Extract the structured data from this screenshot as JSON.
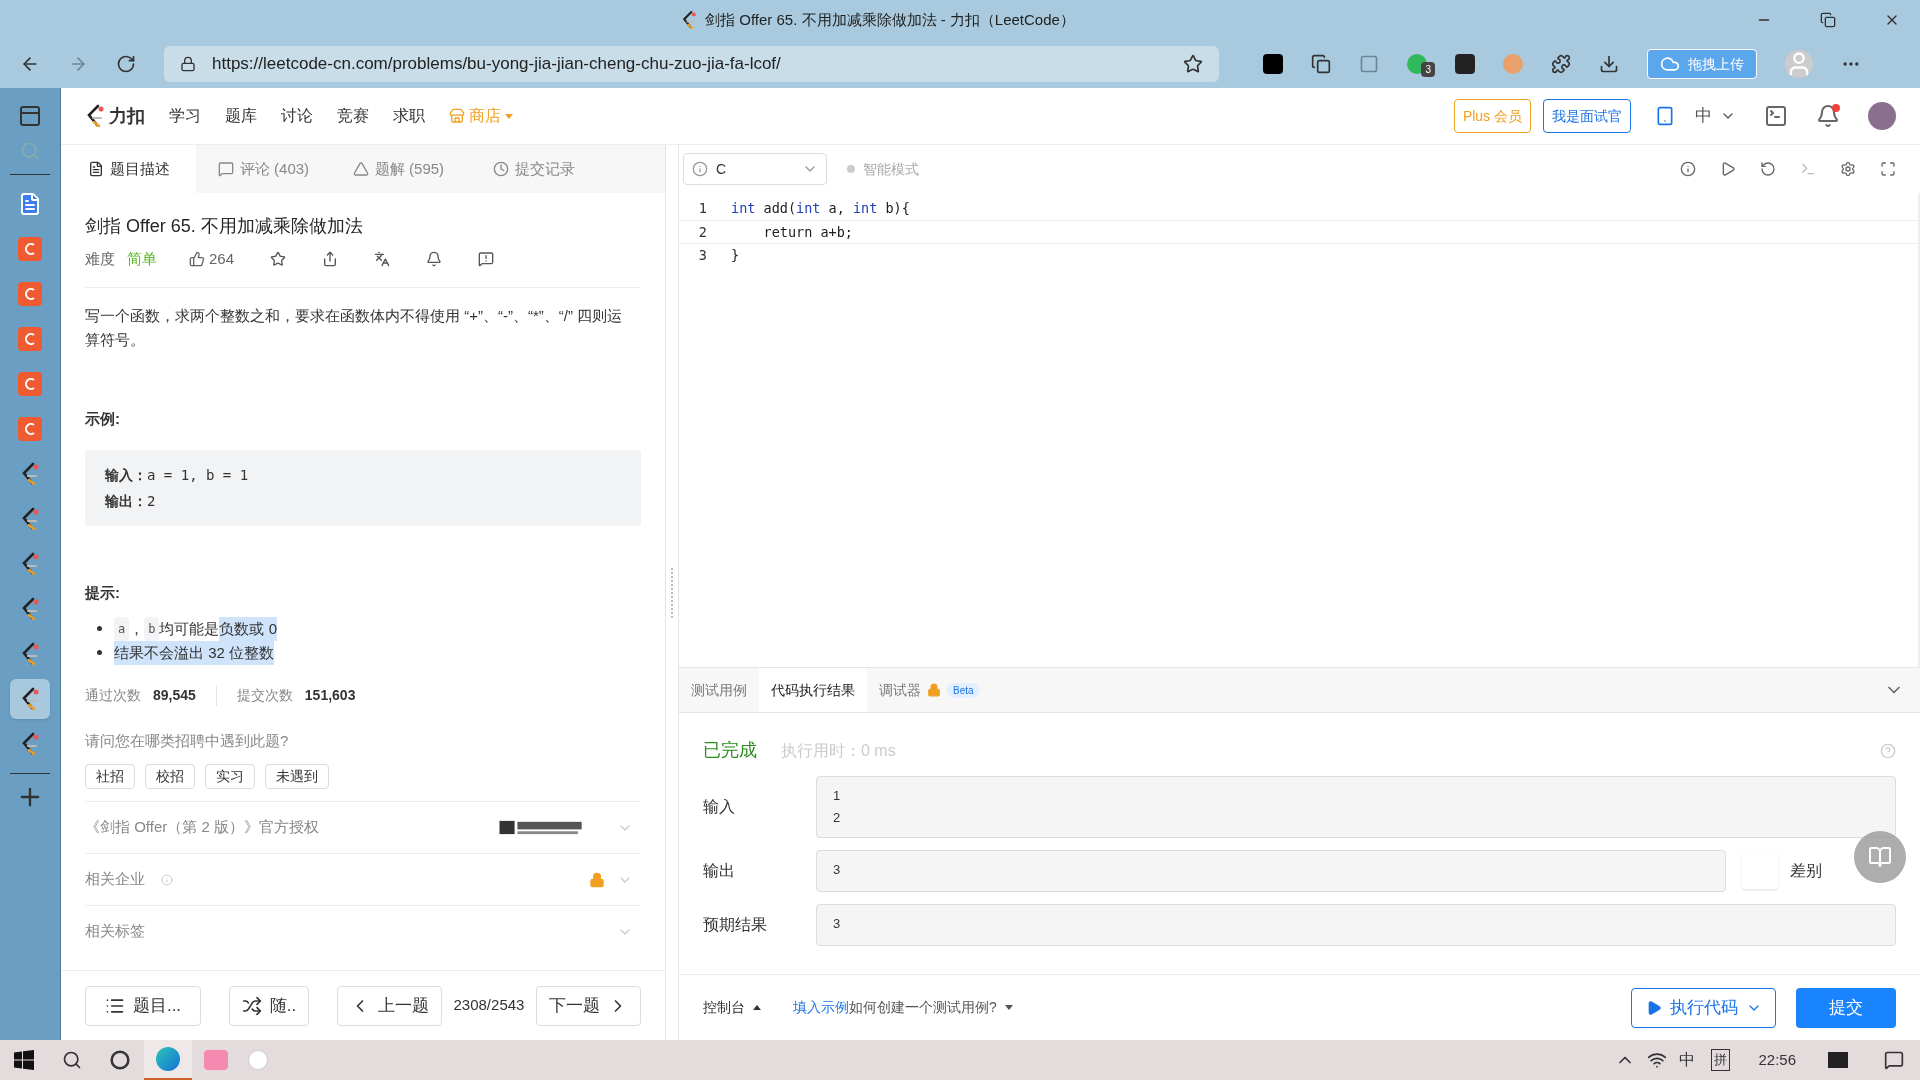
{
  "window": {
    "title": "剑指 Offer 65. 不用加减乘除做加法 - 力扣（LeetCode）"
  },
  "browser": {
    "url": "https://leetcode-cn.com/problems/bu-yong-jia-jian-cheng-chu-zuo-jia-fa-lcof/",
    "extension_badge": "3",
    "upload_button": "拖拽上传"
  },
  "vertical_tabs": [
    {
      "kind": "doc",
      "selected": false
    },
    {
      "kind": "c",
      "selected": false
    },
    {
      "kind": "c",
      "selected": false
    },
    {
      "kind": "c",
      "selected": false
    },
    {
      "kind": "c",
      "selected": false
    },
    {
      "kind": "c",
      "selected": false
    },
    {
      "kind": "leetcode",
      "selected": false
    },
    {
      "kind": "leetcode",
      "selected": false
    },
    {
      "kind": "leetcode",
      "selected": false
    },
    {
      "kind": "leetcode",
      "selected": false
    },
    {
      "kind": "leetcode",
      "selected": false
    },
    {
      "kind": "leetcode",
      "selected": true
    },
    {
      "kind": "leetcode",
      "selected": false
    }
  ],
  "nav": {
    "logo": "力扣",
    "links": [
      "学习",
      "题库",
      "讨论",
      "竞赛",
      "求职"
    ],
    "store": "商店",
    "plus": "Plus 会员",
    "interviewer": "我是面试官",
    "language": "中"
  },
  "panel_tabs": [
    {
      "label": "题目描述",
      "selected": true
    },
    {
      "label": "评论 (403)",
      "selected": false
    },
    {
      "label": "题解 (595)",
      "selected": false
    },
    {
      "label": "提交记录",
      "selected": false
    }
  ],
  "problem": {
    "title": "剑指 Offer 65. 不用加减乘除做加法",
    "difficulty_label": "难度",
    "difficulty": "简单",
    "likes": "264",
    "description": "写一个函数，求两个整数之和，要求在函数体内不得使用 “+”、“-”、“*”、“/” 四则运算符号。",
    "example_heading": "示例:",
    "example": [
      {
        "label": "输入：",
        "value": "a = 1, b = 1"
      },
      {
        "label": "输出：",
        "value": "2"
      }
    ],
    "hints_heading": "提示:",
    "hints": [
      [
        {
          "kind": "code",
          "text": "a",
          "highlighted": false
        },
        {
          "kind": "text",
          "text": "，",
          "highlighted": false
        },
        {
          "kind": "code",
          "text": "b",
          "highlighted": false
        },
        {
          "kind": "text",
          "text": " 均可能是",
          "highlighted": false
        },
        {
          "kind": "text",
          "text": "负数或 0",
          "highlighted": true
        }
      ],
      [
        {
          "kind": "text",
          "text": "结果不会溢出 32 位整数",
          "highlighted": true
        }
      ]
    ],
    "stats": [
      {
        "label": "通过次数",
        "value": "89,545"
      },
      {
        "label": "提交次数",
        "value": "151,603"
      }
    ],
    "question": "请问您在哪类招聘中遇到此题?",
    "tags": [
      "社招",
      "校招",
      "实习",
      "未遇到"
    ],
    "sections": [
      {
        "kind": "publisher",
        "label": "《剑指 Offer（第 2 版）》官方授权"
      },
      {
        "kind": "locked",
        "label": "相关企业"
      },
      {
        "kind": "plain",
        "label": "相关标签"
      }
    ]
  },
  "footer": {
    "list": "题目...",
    "random": "随..",
    "prev": "上一题",
    "position": "2308/2543",
    "next": "下一题"
  },
  "editor": {
    "language": "C",
    "mode": "智能模式",
    "lines": [
      {
        "number": "1",
        "tokens": [
          {
            "kind": "keyword",
            "text": "int"
          },
          {
            "kind": "plain",
            "text": " add("
          },
          {
            "kind": "keyword",
            "text": "int"
          },
          {
            "kind": "plain",
            "text": " a, "
          },
          {
            "kind": "keyword",
            "text": "int"
          },
          {
            "kind": "plain",
            "text": " b){"
          }
        ]
      },
      {
        "number": "2",
        "tokens": [
          {
            "kind": "plain",
            "text": "    return a+b;"
          }
        ]
      },
      {
        "number": "3",
        "tokens": [
          {
            "kind": "plain",
            "text": "}"
          }
        ]
      }
    ]
  },
  "results": {
    "tabs": [
      {
        "label": "测试用例",
        "selected": false,
        "kind": "plain"
      },
      {
        "label": "代码执行结果",
        "selected": true,
        "kind": "plain"
      },
      {
        "label": "调试器",
        "selected": false,
        "kind": "beta",
        "badge": "Beta"
      }
    ],
    "status": "已完成",
    "runtime": "执行用时：0 ms",
    "fields": [
      {
        "label": "输入",
        "lines": [
          "1",
          "2"
        ]
      },
      {
        "label": "输出",
        "lines": [
          "3"
        ],
        "diff": "差别"
      },
      {
        "label": "预期结果",
        "lines": [
          "3"
        ]
      }
    ]
  },
  "actions": {
    "console": "控制台",
    "fill_example": "填入示例",
    "help": "如何创建一个测试用例?",
    "run": "执行代码",
    "submit": "提交"
  },
  "taskbar": {
    "ime": "中",
    "pinyin": "拼",
    "time": "22:56"
  }
}
